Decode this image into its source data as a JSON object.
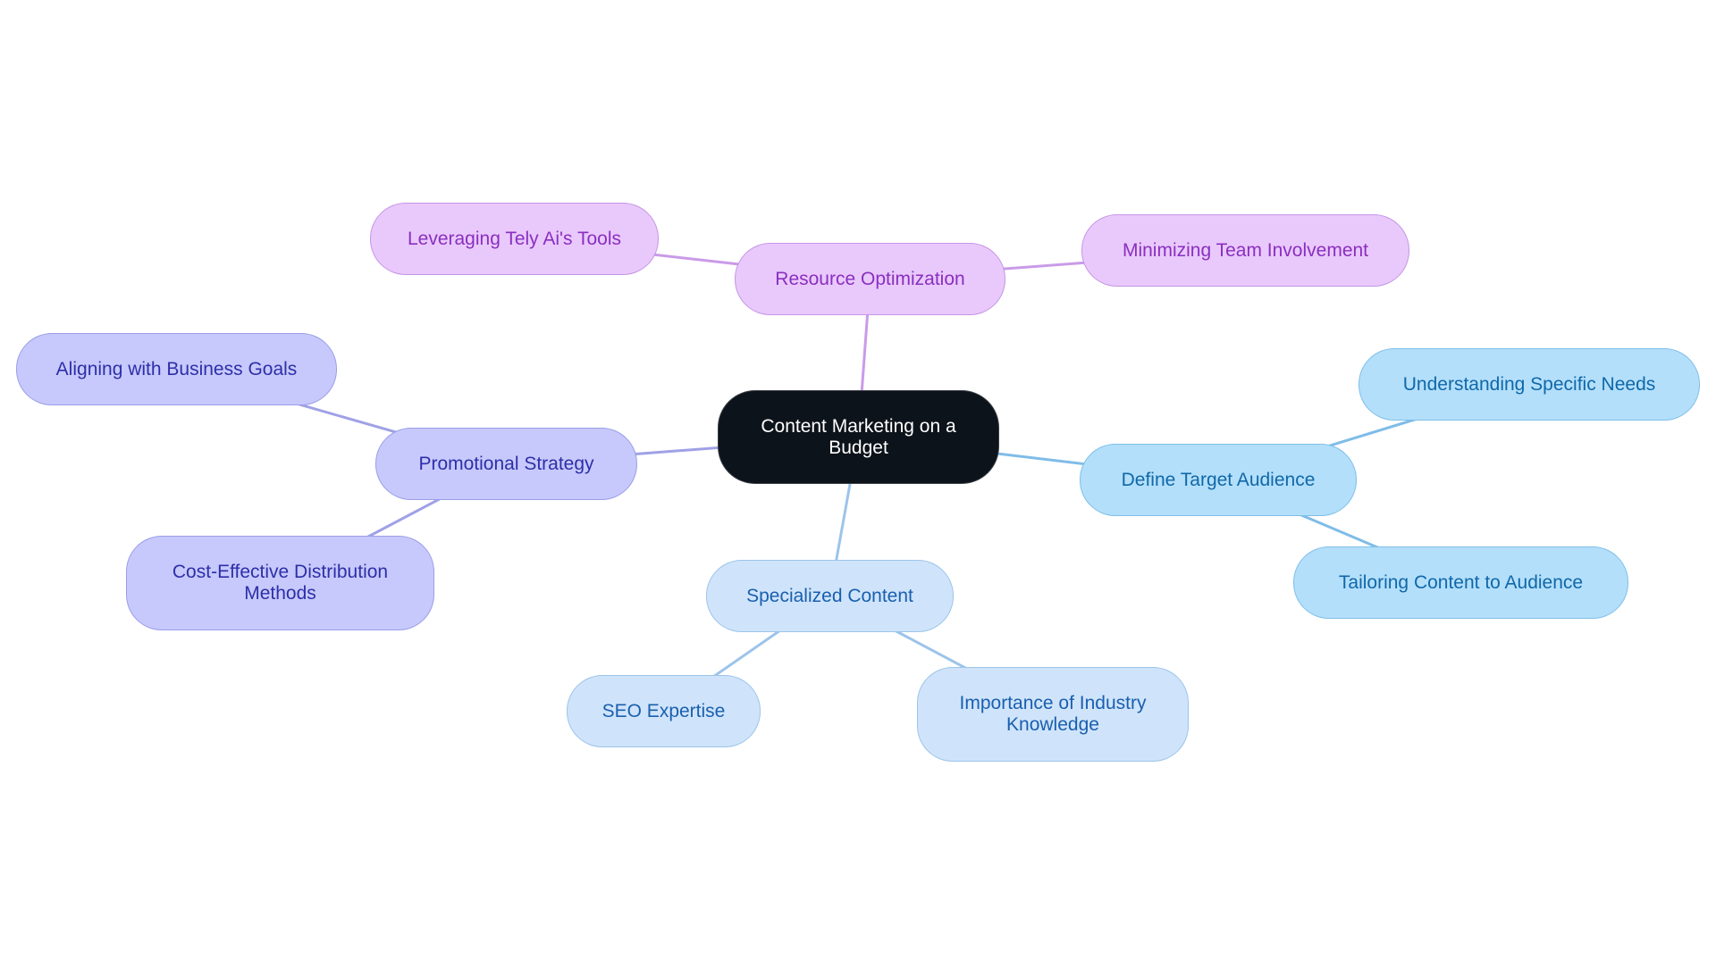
{
  "diagram": {
    "type": "mindmap",
    "root": {
      "id": "root",
      "label": "Content Marketing on a Budget",
      "fill": "#0d131a",
      "stroke": "#3a3f46",
      "text_color": "#ffffff"
    },
    "branches": [
      {
        "id": "resource",
        "label": "Resource Optimization",
        "fill": "#e9c9fb",
        "stroke": "#c596e6",
        "text_color": "#8a2fc0",
        "edge_color": "#c99be8",
        "children": [
          {
            "id": "leveraging",
            "label": "Leveraging Tely Ai's Tools"
          },
          {
            "id": "minimizing",
            "label": "Minimizing Team Involvement"
          }
        ]
      },
      {
        "id": "promotional",
        "label": "Promotional Strategy",
        "fill": "#c7c9fc",
        "stroke": "#9a9ee8",
        "text_color": "#2d2fa8",
        "edge_color": "#9fa1e6",
        "children": [
          {
            "id": "aligning",
            "label": "Aligning with Business Goals"
          },
          {
            "id": "costeffective",
            "label": "Cost-Effective Distribution Methods"
          }
        ]
      },
      {
        "id": "specialized",
        "label": "Specialized Content",
        "fill": "#cfe4fb",
        "stroke": "#9cc4ea",
        "text_color": "#1a5fae",
        "edge_color": "#9cc4ea",
        "children": [
          {
            "id": "seo",
            "label": "SEO Expertise"
          },
          {
            "id": "industry",
            "label": "Importance of Industry Knowledge"
          }
        ]
      },
      {
        "id": "audience",
        "label": "Define Target Audience",
        "fill": "#b3dffb",
        "stroke": "#80bfe8",
        "text_color": "#1068a8",
        "edge_color": "#7fbce8",
        "children": [
          {
            "id": "understanding",
            "label": "Understanding Specific Needs"
          },
          {
            "id": "tailoring",
            "label": "Tailoring Content to Audience"
          }
        ]
      }
    ]
  }
}
